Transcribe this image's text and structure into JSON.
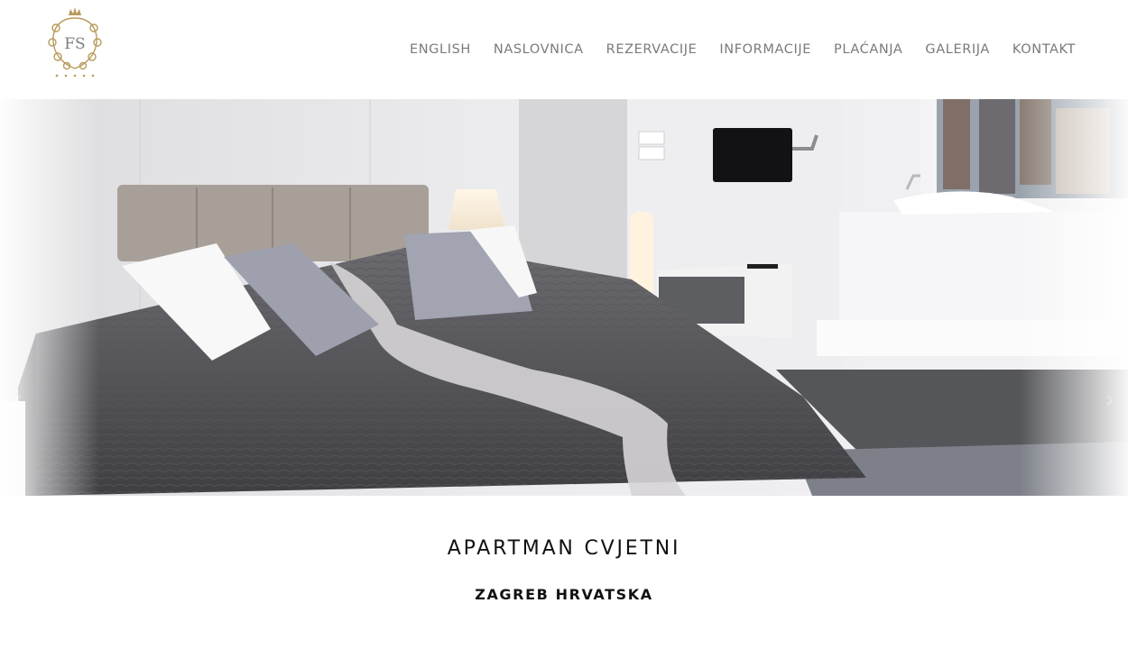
{
  "brand": {
    "logo_text": "FS",
    "accent_color": "#b89a5a",
    "logo_icon": "fs-crest-logo"
  },
  "nav": {
    "items": [
      {
        "label": "ENGLISH"
      },
      {
        "label": "NASLOVNICA"
      },
      {
        "label": "REZERVACIJE"
      },
      {
        "label": "INFORMACIJE"
      },
      {
        "label": "PLAĆANJA"
      },
      {
        "label": "GALERIJA"
      },
      {
        "label": "KONTAKT"
      }
    ],
    "text_color": "#7a7a7a"
  },
  "hero": {
    "image": "bedroom-photo",
    "prev_icon": "chevron-left-icon",
    "next_icon": "chevron-right-icon"
  },
  "main": {
    "title": "APARTMAN CVJETNI",
    "subtitle": "ZAGREB HRVATSKA"
  }
}
